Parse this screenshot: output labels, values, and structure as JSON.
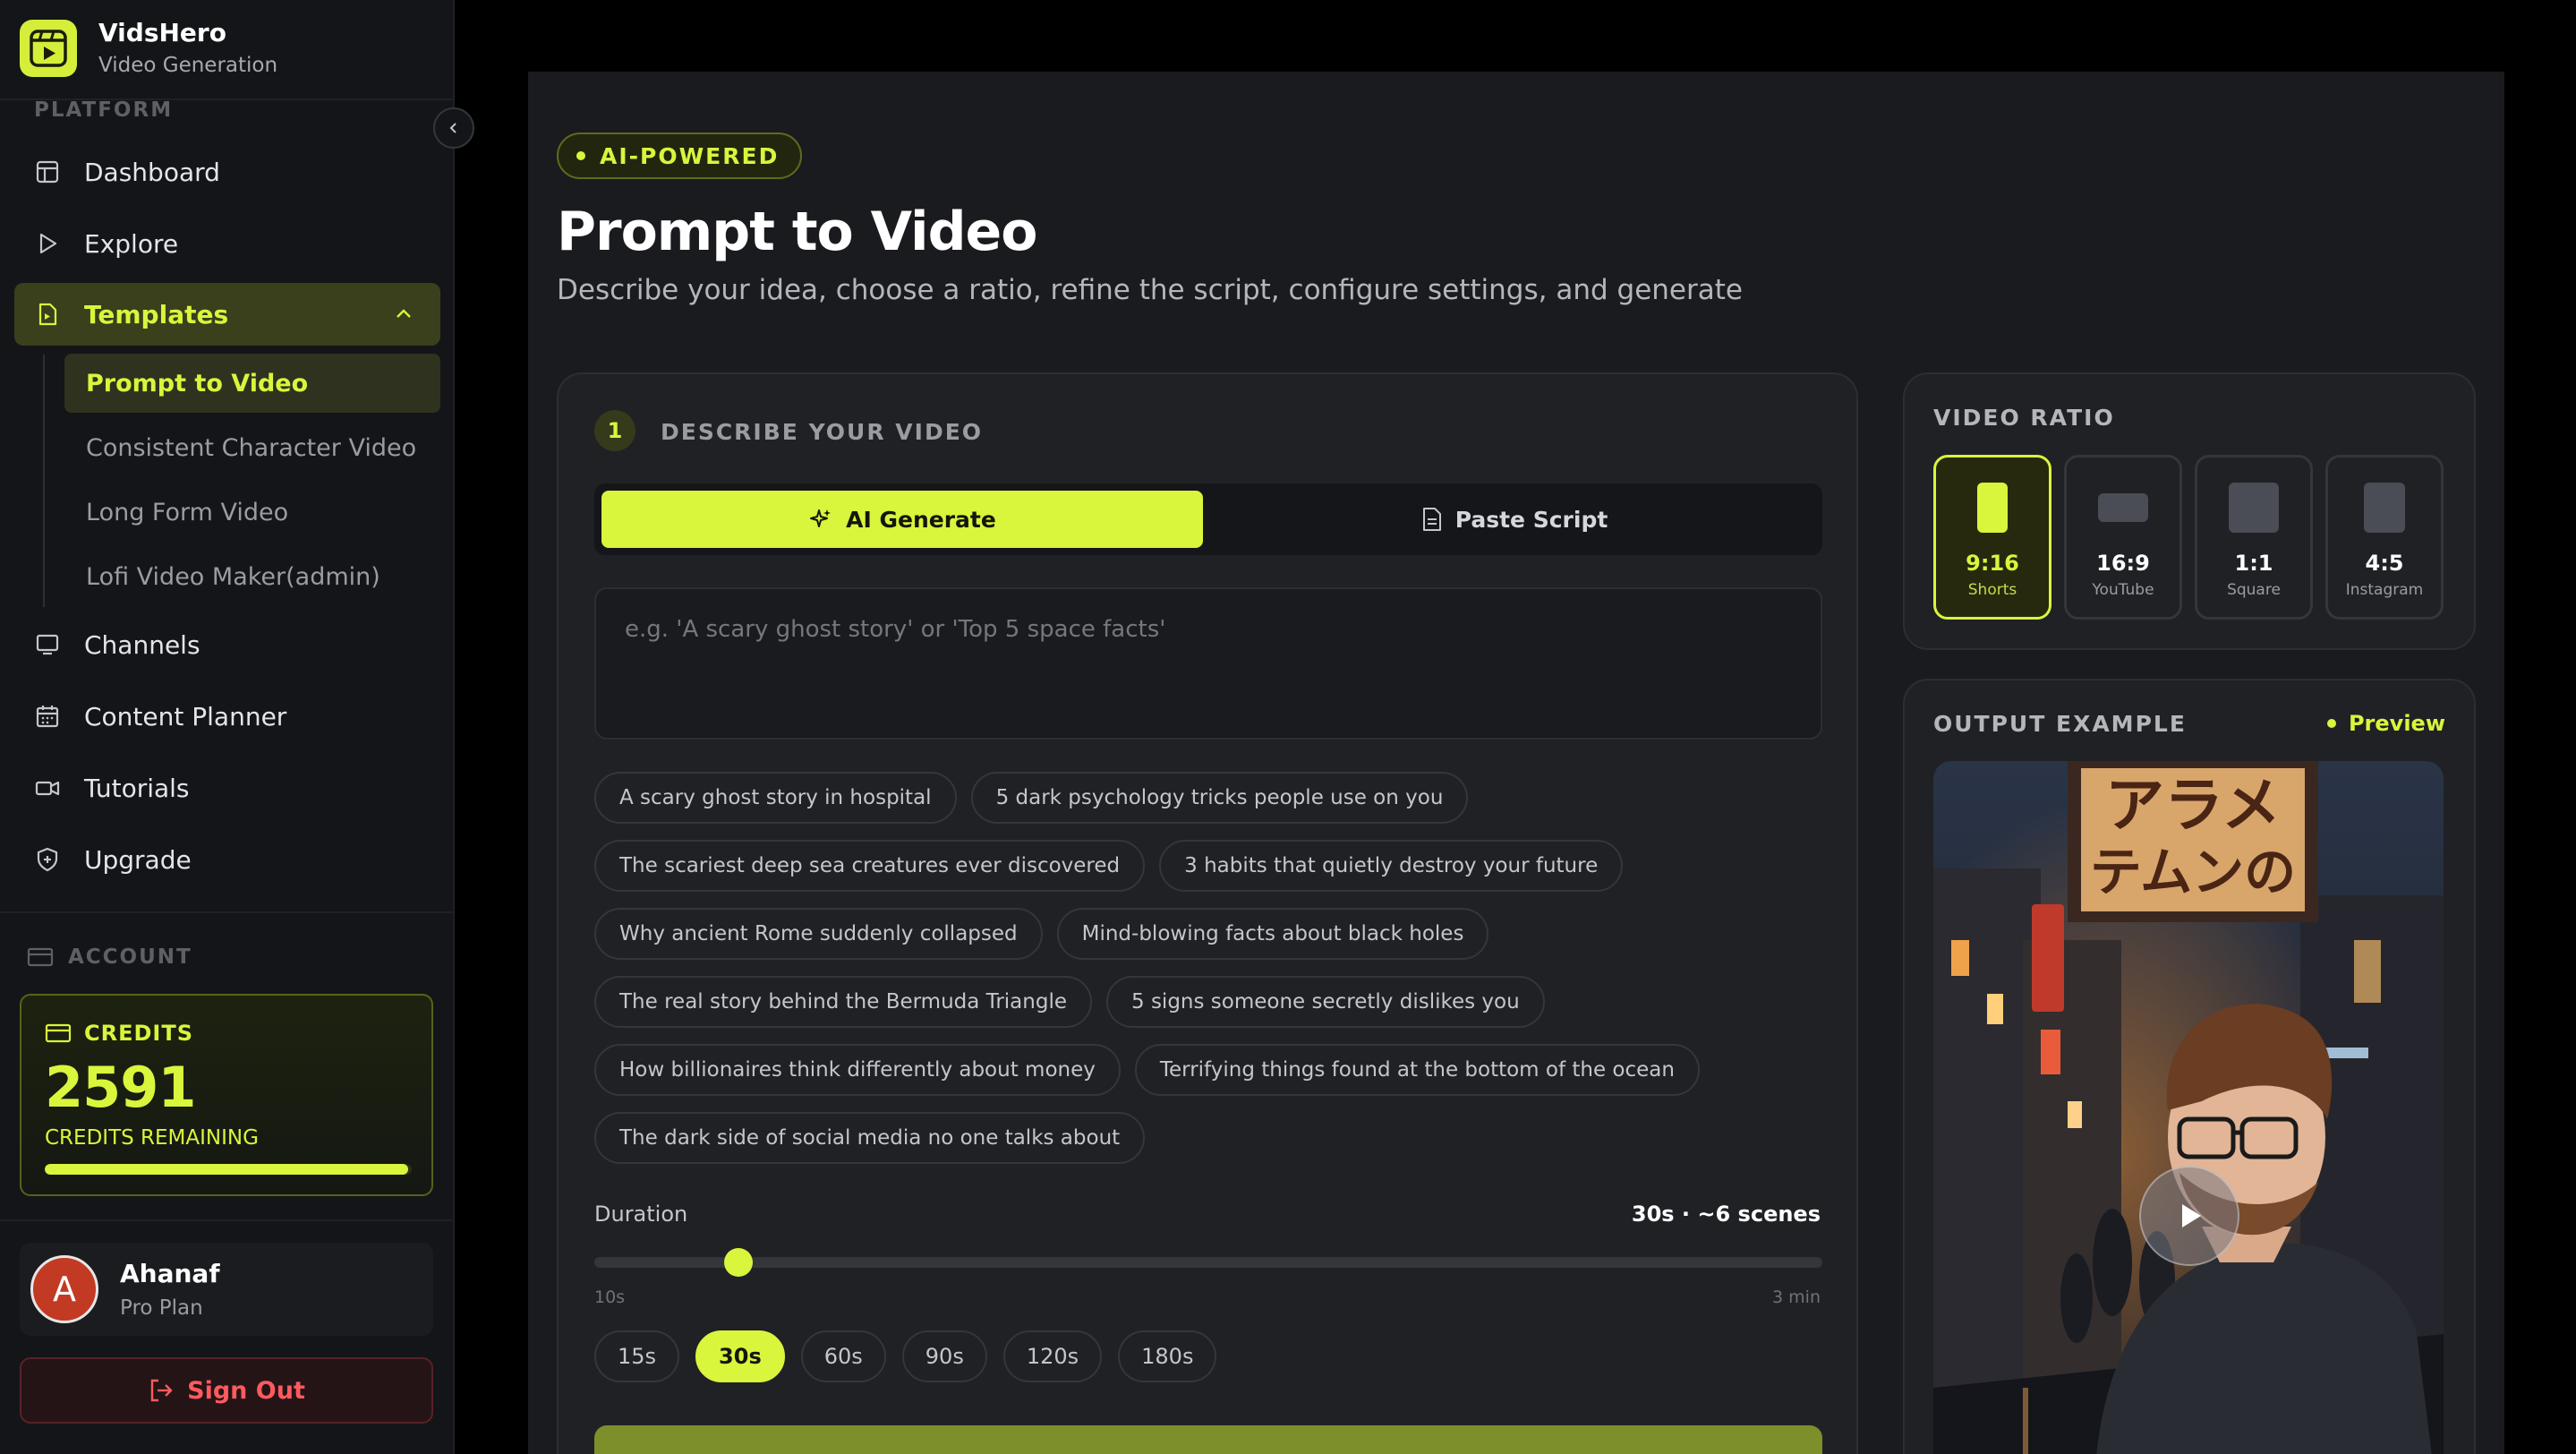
{
  "brand": {
    "name": "VidsHero",
    "subtitle": "Video Generation"
  },
  "sidebar": {
    "platform_label": "PLATFORM",
    "items": [
      {
        "label": "Dashboard",
        "icon": "layout-icon"
      },
      {
        "label": "Explore",
        "icon": "play-triangle-icon"
      },
      {
        "label": "Templates",
        "icon": "file-video-icon",
        "active": true,
        "expanded": true
      },
      {
        "label": "Channels",
        "icon": "monitor-icon"
      },
      {
        "label": "Content Planner",
        "icon": "calendar-icon"
      },
      {
        "label": "Tutorials",
        "icon": "video-camera-icon"
      },
      {
        "label": "Upgrade",
        "icon": "shield-plus-icon"
      }
    ],
    "template_children": [
      {
        "label": "Prompt to Video",
        "active": true
      },
      {
        "label": "Consistent Character Video"
      },
      {
        "label": "Long Form Video"
      },
      {
        "label": "Lofi Video Maker(admin)"
      }
    ],
    "account_label": "ACCOUNT",
    "credits": {
      "title": "CREDITS",
      "value": "2591",
      "label": "CREDITS REMAINING",
      "fill_fraction": 0.99
    },
    "user": {
      "initial": "A",
      "name": "Ahanaf",
      "plan": "Pro Plan"
    },
    "signout_label": "Sign Out"
  },
  "header": {
    "badge": "AI-POWERED",
    "title": "Prompt to Video",
    "subtitle": "Describe your idea, choose a ratio, refine the script, configure settings, and generate"
  },
  "describe": {
    "step": "1",
    "title": "DESCRIBE YOUR VIDEO",
    "tabs": [
      {
        "label": "AI Generate",
        "icon": "sparkles-icon",
        "active": true
      },
      {
        "label": "Paste Script",
        "icon": "document-icon",
        "active": false
      }
    ],
    "prompt": {
      "value": "",
      "placeholder": "e.g. 'A scary ghost story' or 'Top 5 space facts'"
    },
    "suggestions": [
      [
        "A scary ghost story in hospital",
        "5 dark psychology tricks people use on you"
      ],
      [
        "The scariest deep sea creatures ever discovered",
        "3 habits that quietly destroy your future"
      ],
      [
        "Why ancient Rome suddenly collapsed",
        "Mind-blowing facts about black holes"
      ],
      [
        "The real story behind the Bermuda Triangle",
        "5 signs someone secretly dislikes you"
      ],
      [
        "How billionaires think differently about money",
        "Terrifying things found at the bottom of the ocean"
      ],
      [
        "The dark side of social media no one talks about"
      ]
    ],
    "duration": {
      "label": "Duration",
      "value_text": "30s · ~6 scenes",
      "seconds": 30,
      "min_seconds": 10,
      "max_seconds": 180,
      "min_label": "10s",
      "max_label": "3 min",
      "presets": [
        "15s",
        "30s",
        "60s",
        "90s",
        "120s",
        "180s"
      ],
      "active_preset": "30s"
    }
  },
  "ratio": {
    "title": "VIDEO RATIO",
    "options": [
      {
        "value": "9:16",
        "label": "Shorts",
        "active": true
      },
      {
        "value": "16:9",
        "label": "YouTube"
      },
      {
        "value": "1:1",
        "label": "Square"
      },
      {
        "value": "4:5",
        "label": "Instagram"
      }
    ]
  },
  "output": {
    "title": "OUTPUT EXAMPLE",
    "preview_label": "Preview",
    "sign_text": "アラメ\nテムンの"
  },
  "colors": {
    "accent": "#d9f53c",
    "background": "#000000",
    "card": "#202125",
    "danger": "#ff5a5f"
  }
}
